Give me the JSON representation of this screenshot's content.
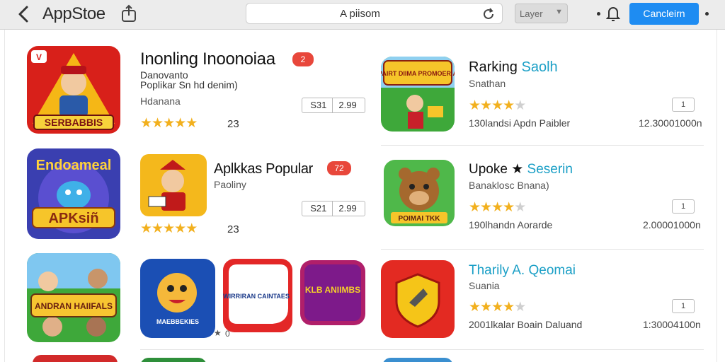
{
  "header": {
    "title": "AppStoe",
    "search_value": "A piisom",
    "layer_select": "Layer",
    "cancel_label": "Cancleirn",
    "back_icon": "chevron-left-icon",
    "share_icon": "share-icon",
    "reload_icon": "reload-icon",
    "bell_icon": "bell-icon"
  },
  "left": {
    "row1": {
      "name": "Inonling Inoonoiaa",
      "badge": "2",
      "line1": "Danovanto",
      "line2": "Poplikar Sn hd denim)",
      "line3": "Hdanana",
      "rating": 5,
      "rating_count": "23",
      "pill_left": "S31",
      "pill_right": "2.99",
      "icon_text": "SERBABBIS"
    },
    "row2": {
      "name": "Aplkkas Popular",
      "badge": "72",
      "line1": "Paoliny",
      "rating": 5,
      "rating_count": "23",
      "pill_left": "S21",
      "pill_right": "2.99",
      "big_icon_title": "Endoameal",
      "big_icon_sub": "APKsiñ"
    },
    "row3": {
      "big_icon_text": "ANDRAN HAIIFALS",
      "tile1_text": "MAEBBEKIES",
      "tile2_text": "WIRRIRAN CAINTAES",
      "tile3_text": "KLB ANIIMBS",
      "caption": "0"
    }
  },
  "right": {
    "row1": {
      "name": "Rarking",
      "name_accent": "Saolh",
      "sub": "Snathan",
      "rating": 4,
      "meta_left": "130landsi Apdn Paibler",
      "meta_right": "12.30001000n",
      "box": "1",
      "icon_text": "PAIRT DIIMA PROMOERIA"
    },
    "row2": {
      "name": "Upoke",
      "name_accent": "Seserin",
      "sub": "Banaklosc Bnana)",
      "rating": 4,
      "meta_left": "190lhandn Aorarde",
      "meta_right": "2.00001000n",
      "box": "1",
      "icon_text": "POIMAI TKK"
    },
    "row3": {
      "name": "Tharily A.",
      "name_accent": "Qeomai",
      "sub": "Suania",
      "rating": 4,
      "meta_left": "2001lkalar Boain Daluand",
      "meta_right": "1:30004100n",
      "box": "1"
    }
  },
  "colors": {
    "accent": "#1e8cf2",
    "badge": "#e8473b",
    "star": "#f2b01e",
    "teal": "#1a9fc6"
  }
}
